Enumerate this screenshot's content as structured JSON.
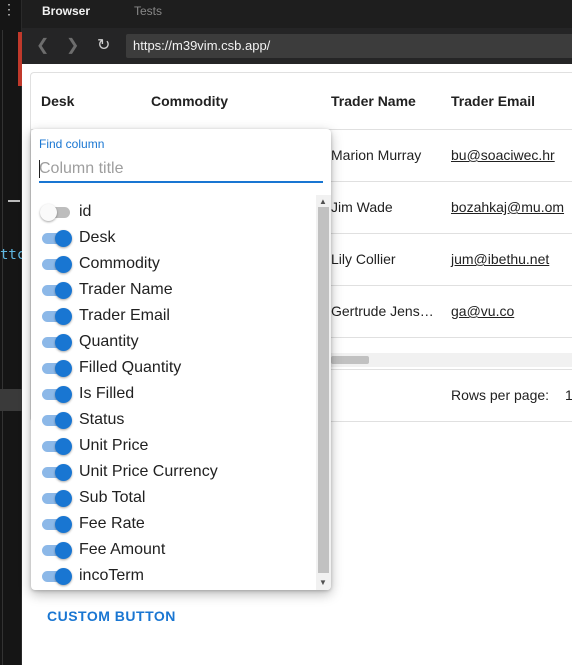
{
  "browser": {
    "tabs": [
      {
        "label": "Browser",
        "active": true
      },
      {
        "label": "Tests",
        "active": false
      }
    ],
    "url": "https://m39vim.csb.app/"
  },
  "editor": {
    "code_fragment": "ttc"
  },
  "grid": {
    "columns": [
      "Desk",
      "Commodity",
      "Trader Name",
      "Trader Email"
    ],
    "rows": [
      {
        "trader_name": "Marion Murray",
        "trader_email": "bu@soaciwec.hr"
      },
      {
        "trader_name": "Jim Wade",
        "trader_email": "bozahkaj@mu.om"
      },
      {
        "trader_name": "Lily Collier",
        "trader_email": "jum@ibethu.net"
      },
      {
        "trader_name": "Gertrude Jens…",
        "trader_email": "ga@vu.co"
      }
    ],
    "pagination": {
      "rows_per_page_label": "Rows per page:",
      "rows_per_page_value": "1"
    }
  },
  "column_panel": {
    "find_label": "Find column",
    "find_placeholder": "Column title",
    "columns": [
      {
        "label": "id",
        "visible": false
      },
      {
        "label": "Desk",
        "visible": true
      },
      {
        "label": "Commodity",
        "visible": true
      },
      {
        "label": "Trader Name",
        "visible": true
      },
      {
        "label": "Trader Email",
        "visible": true
      },
      {
        "label": "Quantity",
        "visible": true
      },
      {
        "label": "Filled Quantity",
        "visible": true
      },
      {
        "label": "Is Filled",
        "visible": true
      },
      {
        "label": "Status",
        "visible": true
      },
      {
        "label": "Unit Price",
        "visible": true
      },
      {
        "label": "Unit Price Currency",
        "visible": true
      },
      {
        "label": "Sub Total",
        "visible": true
      },
      {
        "label": "Fee Rate",
        "visible": true
      },
      {
        "label": "Fee Amount",
        "visible": true
      },
      {
        "label": "incoTerm",
        "visible": true
      }
    ]
  },
  "custom_button_label": "CUSTOM BUTTON",
  "colors": {
    "accent": "#1976d2",
    "switch_track_on": "#8cb8e8"
  }
}
